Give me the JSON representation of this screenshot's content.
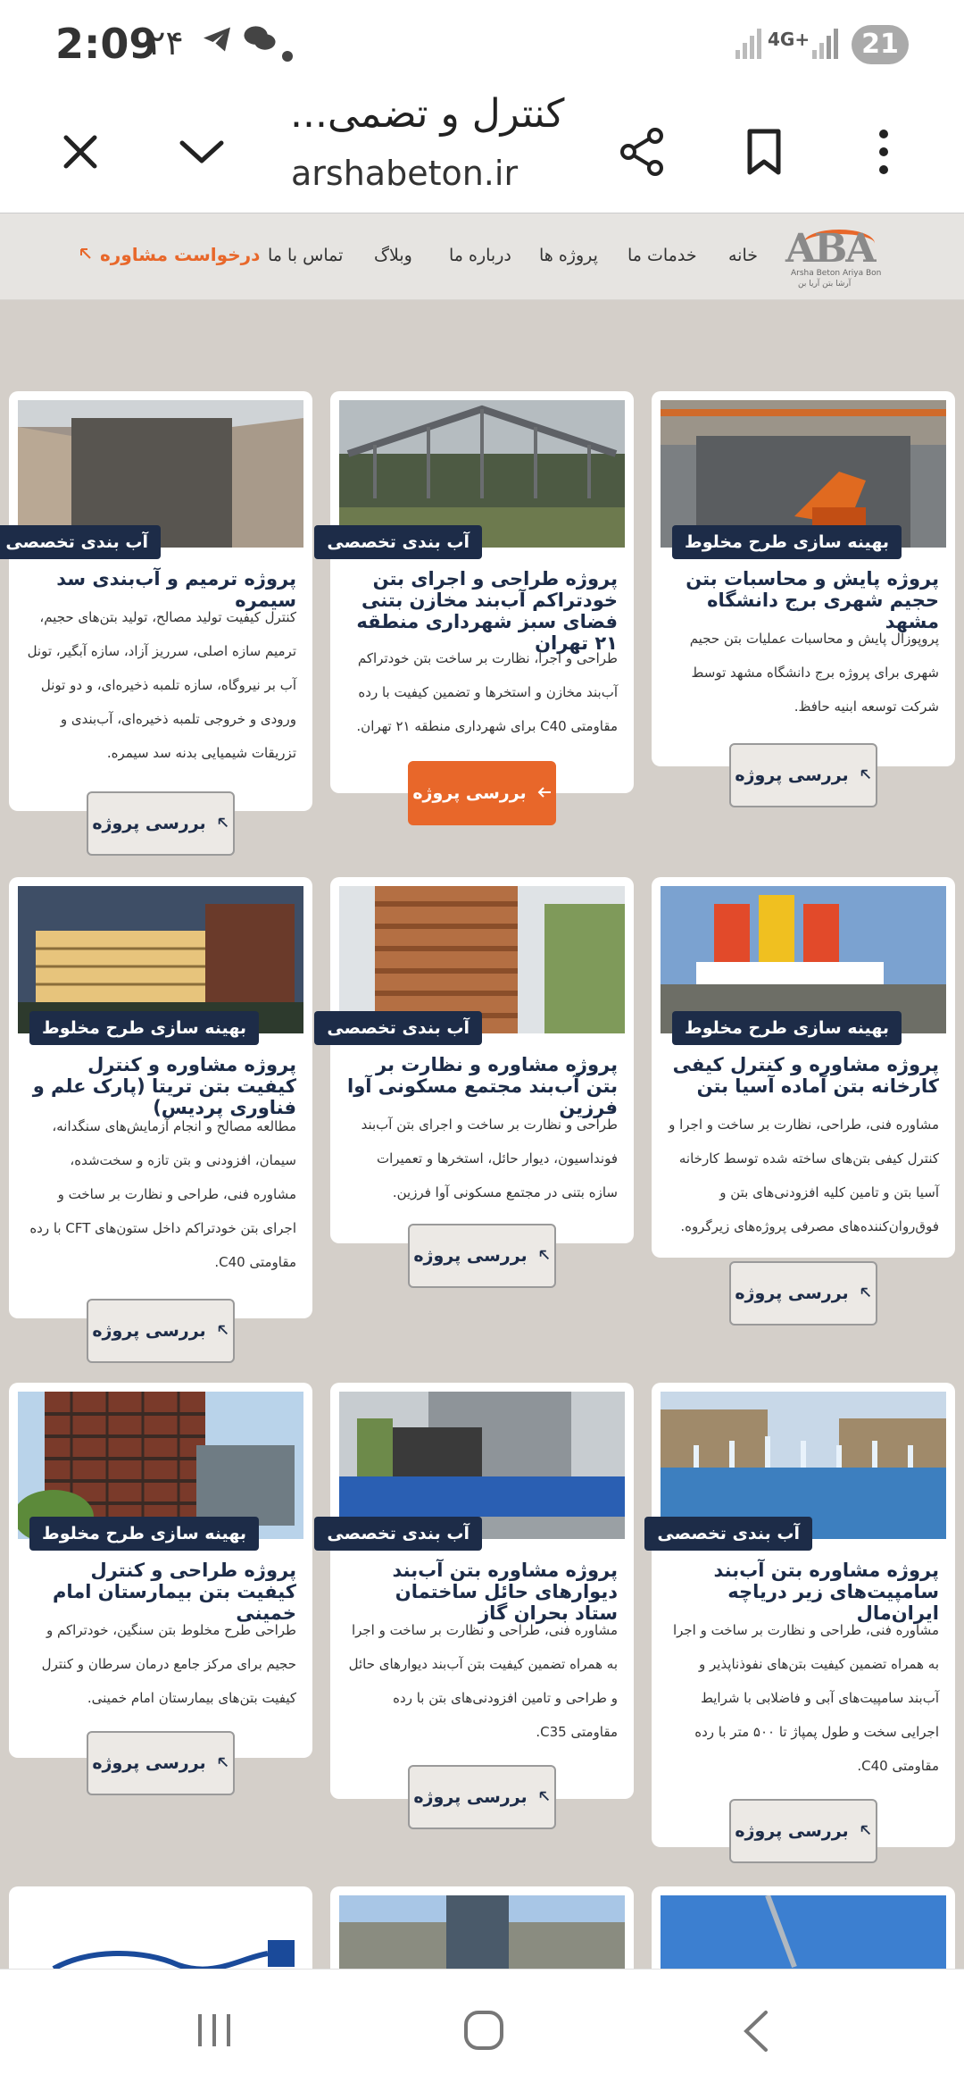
{
  "status_bar": {
    "time": "2:09",
    "notification_count": "۲۴",
    "network": "4G+",
    "battery": "21"
  },
  "browser": {
    "page_title": "کنترل و تضمی...",
    "url": "arshabeton.ir"
  },
  "site_nav": {
    "logo_text": "ABA",
    "logo_subtitle": "Arsha Beton Ariya Bon",
    "logo_subtitle_fa": "آرشا بتن آریا بن",
    "items": [
      "خانه",
      "خدمات ما",
      "پروژه ها",
      "درباره ما",
      "وبلاگ",
      "تماس با ما"
    ],
    "cta": "درخواست مشاوره"
  },
  "colors": {
    "accent": "#e8672a",
    "navy": "#1d2c48",
    "content_bg": "#d4cfc9"
  },
  "projects": [
    {
      "badge": "بهینه سازی طرح مخلوط",
      "title": "پروژه پایش و محاسبات بتن حجیم شهری برج دانشگاه مشهد",
      "description": "پروپوزال پایش و محاسبات عملیات بتن حجیم شهری برای پروژه برج دانشگاه مشهد توسط شرکت توسعه ابنیه حافظ.",
      "button": "بررسی پروژه"
    },
    {
      "badge": "آب بندی تخصصی",
      "title": "پروژه طراحی و اجرای بتن خودتراکم آب‌بند مخازن بتنی فضای سبز شهرداری منطقه ۲۱ تهران",
      "description": "طراحی و اجرا، نظارت بر ساخت بتن خودتراکم آب‌بند مخازن و استخرها و تضمین کیفیت با رده مقاومتی C40 برای شهرداری منطقه ۲۱ تهران.",
      "button": "بررسی پروژه"
    },
    {
      "badge": "آب بندی تخصصی",
      "title": "پروژه ترمیم و آب‌بندی سد سیمره",
      "description": "کنترل کیفیت تولید مصالح، تولید بتن‌های حجیم، ترمیم سازه اصلی، سرریز آزاد، سازه آبگیر، تونل آب بر نیروگاه، سازه تلمبه ذخیره‌ای، و دو تونل ورودی و خروجی تلمبه ذخیره‌ای، آب‌بندی و تزریقات شیمیایی بدنه سد سیمره.",
      "button": "بررسی پروژه"
    },
    {
      "badge": "بهینه سازی طرح مخلوط",
      "title": "پروژه مشاوره و کنترل کیفی کارخانه بتن آماده آسیا بتن",
      "description": "مشاوره فنی، طراحی، نظارت بر ساخت و اجرا و کنترل کیفی بتن‌های ساخته شده توسط کارخانه آسیا بتن و تامین کلیه افزودنی‌های بتن و فوق‌روان‌کننده‌های مصرفی پروژه‌های زیرگروه.",
      "button": "بررسی پروژه"
    },
    {
      "badge": "آب بندی تخصصی",
      "title": "پروژه مشاوره و نظارت بر بتن آب‌بند مجتمع مسکونی آوا فرزین",
      "description": "طراحی و نظارت بر ساخت و اجرای بتن آب‌بند فونداسیون، دیوار حائل، استخرها و تعمیرات سازه بتنی در مجتمع مسکونی آوا فرزین.",
      "button": "بررسی پروژه"
    },
    {
      "badge": "بهینه سازی طرح مخلوط",
      "title": "پروژه مشاوره و کنترل کیفیت بتن تریتا (پارک علم و فناوری پردیس)",
      "description": "مطالعه مصالح و انجام آزمایش‌های سنگدانه، سیمان، افزودنی و بتن تازه و سخت‌شده، مشاوره فنی، طراحی و نظارت بر ساخت و اجرای بتن خودتراکم داخل ستون‌های CFT با رده مقاومتی C40.",
      "button": "بررسی پروژه"
    },
    {
      "badge": "آب بندی تخصصی",
      "title": "پروژه مشاوره بتن آب‌بند سامپیت‌های زیر دریاچه ایران‌مال",
      "description": "مشاوره فنی، طراحی و نظارت بر ساخت و اجرا به همراه تضمین کیفیت بتن‌های نفوذناپذیر و آب‌بند سامپیت‌های آبی و فاضلابی با شرایط اجرایی سخت و طول پمپاژ تا ۵۰۰ متر با رده مقاومتی C40.",
      "button": "بررسی پروژه"
    },
    {
      "badge": "آب بندی تخصصی",
      "title": "پروژه مشاوره بتن آب‌بند دیوارهای حائل ساختمان ستاد بحران گاز",
      "description": "مشاوره فنی، طراحی و نظارت بر ساخت و اجرا به همراه تضمین کیفیت بتن آب‌بند دیوارهای حائل و طراحی و تامین افزودنی‌های بتن با رده مقاومتی C35.",
      "button": "بررسی پروژه"
    },
    {
      "badge": "بهینه سازی طرح مخلوط",
      "title": "پروژه طراحی و کنترل کیفیت بتن بیمارستان امام خمینی",
      "description": "طراحی طرح مخلوط بتن سنگین، خودتراکم و حجیم برای مرکز جامع درمان سرطان و کنترل کیفیت بتن‌های بیمارستان امام خمینی.",
      "button": "بررسی پروژه"
    }
  ]
}
